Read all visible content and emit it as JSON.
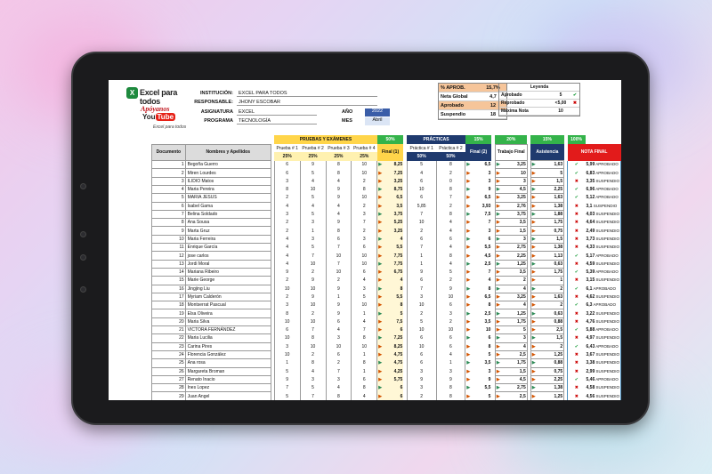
{
  "brand": {
    "logo_letter": "X",
    "name": "Excel para todos",
    "apoyanos": "Apóyanos",
    "youtube_a": "You",
    "youtube_b": "Tube",
    "signature": "Excel para todos"
  },
  "info": {
    "institucion_label": "INSTITUCIÓN:",
    "institucion": "EXCEL PARA TODOS",
    "responsable_label": "RESPONSABLE:",
    "responsable": "JHONY ESCOBAR",
    "asignatura_label": "ASIGNATURA",
    "asignatura": "EXCEL",
    "programa_label": "PROGRAMA",
    "programa": "TECNOLOGÍA",
    "anio_label": "AÑO",
    "anio": "2022",
    "mes_label": "MES",
    "mes": "Abril"
  },
  "stats": {
    "aprob_label": "% APROB.",
    "aprob": "15,7%",
    "neta_label": "Neta Global",
    "neta": "4,7",
    "aprobado_label": "Aprobado",
    "aprobado": "12",
    "suspendio_label": "Suspendio",
    "suspendio": "18"
  },
  "leyenda": {
    "title": "Leyenda",
    "aprobado_label": "Aprobado",
    "aprobado": "5",
    "reprobado_label": "Reprobado",
    "reprobado": "<5,00",
    "maxima_label": "Máxima Nota",
    "maxima": "10"
  },
  "headers": {
    "pruebas": "PRUEBAS Y EXÁMENES",
    "pruebas_pct": "50%",
    "practicas": "PRÁCTICAS",
    "practicas_pct": "15%",
    "trabajo_pct": "20%",
    "asist_pct": "15%",
    "total_pct": "100%",
    "documento": "Documento",
    "nombres": "Nombres y Apellidos",
    "p1": "Prueba # 1",
    "p2": "Prueba # 2",
    "p3": "Prueba # 3",
    "p4": "Prueba # 4",
    "pw": "25%",
    "final1": "Final (1)",
    "pr1": "Práctica # 1",
    "pr2": "Práctica # 2",
    "prw": "50%",
    "final2": "Final (2)",
    "trabajo": "Trabajo Final",
    "asistencia": "Asistencia",
    "nota": "NOTA FINAL"
  },
  "colors": {
    "yellow": "#ffd54a",
    "yellow_light": "#fff1b0",
    "navy": "#1f3a6e",
    "green": "#34b34a",
    "red": "#e21b1b",
    "teal": "#6fb7b5",
    "stat_orange": "#f6c59a"
  },
  "rows": [
    [
      1,
      "Begoña Guerro",
      "6",
      "9",
      "8",
      "10",
      "8,25",
      "5",
      "8",
      "6,5",
      "3,25",
      "1,63",
      "5,99",
      "APROBADO",
      1
    ],
    [
      2,
      "Miren Lourdes",
      "6",
      "5",
      "8",
      "10",
      "7,25",
      "4",
      "2",
      "3",
      "10",
      "5",
      "6,83",
      "APROBADO",
      1
    ],
    [
      3,
      "ILIDIO Matos",
      "3",
      "4",
      "4",
      "2",
      "3,25",
      "6",
      "0",
      "3",
      "3",
      "1,5",
      "3,35",
      "SUSPENDIO",
      0
    ],
    [
      4,
      "Maria Pereira",
      "8",
      "10",
      "9",
      "8",
      "8,75",
      "10",
      "8",
      "9",
      "4,5",
      "2,25",
      "6,96",
      "APROBADO",
      1
    ],
    [
      5,
      "MARIA JESUS",
      "2",
      "5",
      "9",
      "10",
      "6,5",
      "6",
      "7",
      "6,5",
      "3,25",
      "1,63",
      "5,12",
      "APROBADO",
      1
    ],
    [
      6,
      "Isabel Gama",
      "4",
      "4",
      "4",
      "2",
      "3,5",
      "5,85",
      "2",
      "3,93",
      "2,76",
      "1,38",
      "3,1",
      "SUSPENDIO",
      0
    ],
    [
      7,
      "Belina Soldado",
      "3",
      "5",
      "4",
      "3",
      "3,75",
      "7",
      "8",
      "7,5",
      "3,75",
      "1,88",
      "4,03",
      "SUSPENDIO",
      0
    ],
    [
      8,
      "Ana Sousa",
      "2",
      "3",
      "9",
      "7",
      "5,25",
      "10",
      "4",
      "7",
      "3,5",
      "1,75",
      "4,64",
      "SUSPENDIO",
      0
    ],
    [
      9,
      "Marta Gruz",
      "2",
      "1",
      "8",
      "2",
      "3,25",
      "2",
      "4",
      "3",
      "1,5",
      "0,75",
      "2,49",
      "SUSPENDIO",
      0
    ],
    [
      10,
      "Maria Ferreira",
      "4",
      "3",
      "6",
      "3",
      "4",
      "6",
      "6",
      "6",
      "3",
      "1,5",
      "3,73",
      "SUSPENDIO",
      0
    ],
    [
      11,
      "Enrique García",
      "4",
      "5",
      "7",
      "6",
      "5,5",
      "7",
      "4",
      "5,5",
      "2,75",
      "1,38",
      "4,33",
      "SUSPENDIO",
      0
    ],
    [
      12,
      "jose carlos",
      "4",
      "7",
      "10",
      "10",
      "7,75",
      "1",
      "8",
      "4,5",
      "2,25",
      "1,13",
      "5,17",
      "APROBADO",
      1
    ],
    [
      13,
      "Jordi Moral",
      "4",
      "10",
      "7",
      "10",
      "7,75",
      "1",
      "4",
      "2,5",
      "1,25",
      "0,63",
      "4,59",
      "SUSPENDIO",
      0
    ],
    [
      14,
      "Mariana Ribeiro",
      "9",
      "2",
      "10",
      "6",
      "6,75",
      "9",
      "5",
      "7",
      "3,5",
      "1,75",
      "5,39",
      "APROBADO",
      1
    ],
    [
      15,
      "Marie George",
      "2",
      "9",
      "2",
      "4",
      "4",
      "6",
      "2",
      "4",
      "2",
      "1",
      "3,15",
      "SUSPENDIO",
      0
    ],
    [
      16,
      "Jingjing Liu",
      "10",
      "10",
      "9",
      "3",
      "8",
      "7",
      "9",
      "8",
      "4",
      "2",
      "6,1",
      "APROBADO",
      1
    ],
    [
      17,
      "Myriam Calderón",
      "2",
      "9",
      "1",
      "5",
      "5,5",
      "3",
      "10",
      "6,5",
      "3,25",
      "1,63",
      "4,62",
      "SUSPENDIO",
      0
    ],
    [
      18,
      "Montserrat Pascual",
      "3",
      "10",
      "9",
      "10",
      "8",
      "10",
      "6",
      "8",
      "4",
      "2",
      "6,3",
      "APROBADO",
      1
    ],
    [
      19,
      "Elsa Oliveira",
      "8",
      "2",
      "9",
      "1",
      "5",
      "2",
      "3",
      "2,5",
      "1,25",
      "0,63",
      "3,22",
      "SUSPENDIO",
      0
    ],
    [
      20,
      "Maria Silva",
      "10",
      "10",
      "6",
      "4",
      "7,5",
      "5",
      "2",
      "3,5",
      "1,75",
      "0,88",
      "4,76",
      "SUSPENDIO",
      0
    ],
    [
      21,
      "VICTORA FERNÁNDEZ",
      "6",
      "7",
      "4",
      "7",
      "6",
      "10",
      "10",
      "10",
      "5",
      "2,5",
      "5,88",
      "APROBADO",
      1
    ],
    [
      22,
      "Maria Lucilia",
      "10",
      "8",
      "3",
      "8",
      "7,25",
      "6",
      "6",
      "6",
      "3",
      "1,5",
      "4,97",
      "SUSPENDIO",
      0
    ],
    [
      23,
      "Carina Pires",
      "3",
      "10",
      "10",
      "10",
      "8,25",
      "10",
      "6",
      "8",
      "4",
      "2",
      "6,43",
      "APROBADO",
      1
    ],
    [
      24,
      "Florencia González",
      "10",
      "2",
      "6",
      "1",
      "4,75",
      "6",
      "4",
      "5",
      "2,5",
      "1,25",
      "3,67",
      "SUSPENDIO",
      0
    ],
    [
      25,
      "Ana rosa",
      "1",
      "8",
      "2",
      "8",
      "4,75",
      "6",
      "1",
      "3,5",
      "1,75",
      "0,88",
      "3,38",
      "SUSPENDIO",
      0
    ],
    [
      26,
      "Margareta Broman",
      "5",
      "4",
      "7",
      "1",
      "4,25",
      "3",
      "3",
      "3",
      "1,5",
      "0,75",
      "2,99",
      "SUSPENDIO",
      0
    ],
    [
      27,
      "Renato Inacio",
      "9",
      "3",
      "3",
      "6",
      "5,75",
      "9",
      "9",
      "9",
      "4,5",
      "2,25",
      "5,46",
      "APROBADO",
      1
    ],
    [
      28,
      "Ines Lopez",
      "7",
      "5",
      "4",
      "8",
      "6",
      "3",
      "8",
      "5,5",
      "2,75",
      "1,38",
      "4,58",
      "SUSPENDIO",
      0
    ],
    [
      29,
      "Juan Angel",
      "5",
      "7",
      "8",
      "4",
      "6",
      "2",
      "8",
      "5",
      "2,5",
      "1,25",
      "4,56",
      "SUSPENDIO",
      0
    ],
    [
      30,
      "Jose Lapeña",
      "4",
      "3",
      "5",
      "9",
      "5,25",
      "5",
      "4",
      "4,5",
      "2,25",
      "1,13",
      "3,92",
      "SUSPENDIO",
      0
    ]
  ]
}
